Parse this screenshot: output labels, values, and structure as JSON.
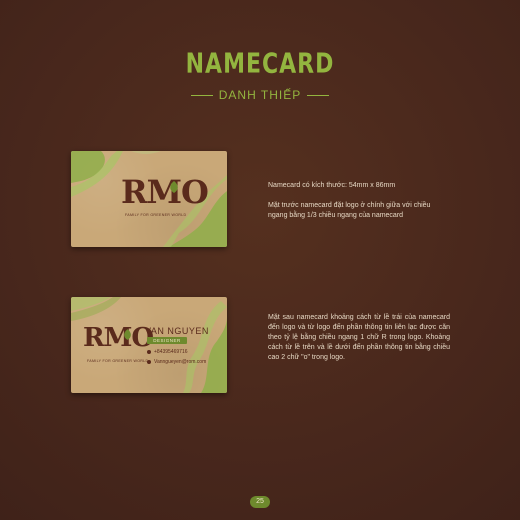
{
  "header": {
    "title": "NAMECARD",
    "subtitle": "DANH THIẾP"
  },
  "front_card": {
    "logo": "RMO",
    "tagline": "FAMILY FOR GREENER WORLD"
  },
  "back_card": {
    "logo": "RMO",
    "tagline": "FAMILY FOR GREENER WORLD",
    "name": "VAN NGUYEN",
    "role": "DESIGNER",
    "phone": "+84395469716",
    "email": "Vanngueyen@rom.com"
  },
  "front_description": {
    "size": "Namecard có kích thước: 54mm x 86mm",
    "para": "Mặt trước namecard đặt logo ở chính giữa với chiều ngang bằng 1/3 chiều ngang của namecard"
  },
  "back_description": "Mặt sau namecard khoảng cách từ lề trái của namecard đến logo và từ logo đến phần thông tin liên lạc được căn theo tỷ lệ bằng chiều ngang 1 chữ R trong logo. Khoảng cách từ lề trên và lề dưới đến phần thông tin bằng chiều cao 2 chữ \"o\" trong logo.",
  "page_number": "25",
  "colors": {
    "background": "#4a2a1f",
    "accent_green": "#93b53f",
    "kraft": "#c9a878",
    "logo_brown": "#5a2a1c"
  }
}
